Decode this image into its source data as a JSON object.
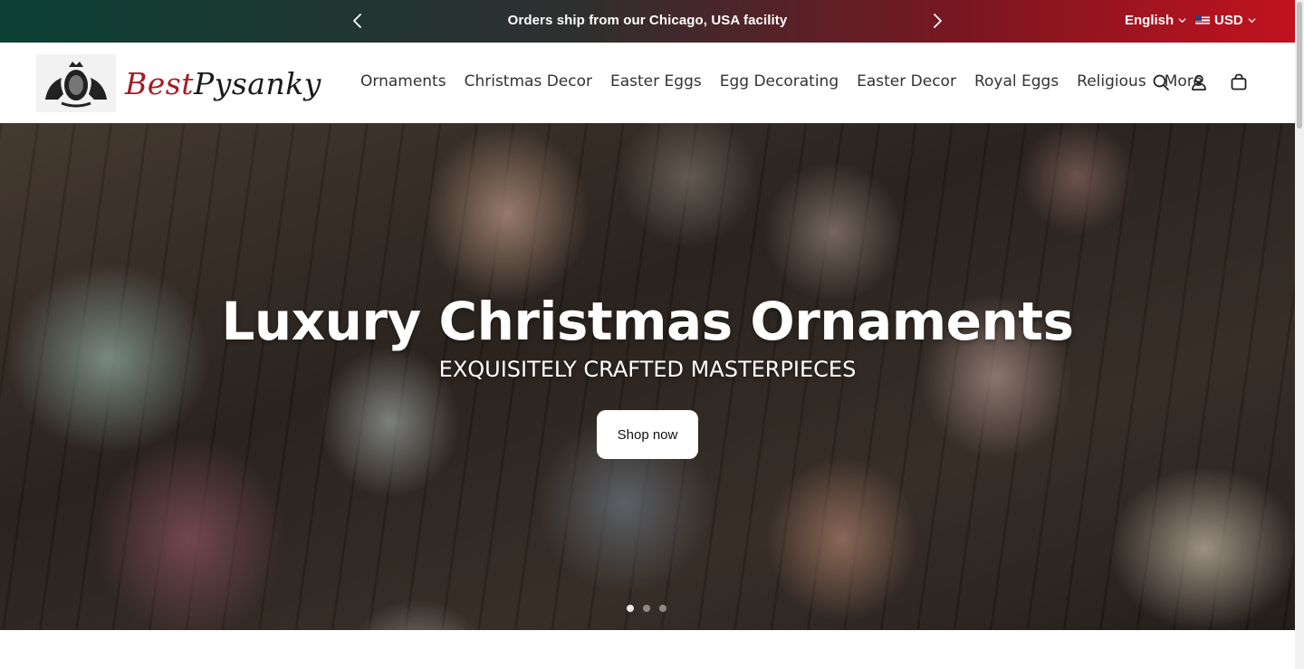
{
  "announcement": {
    "message": "Orders ship from our Chicago, USA facility",
    "language": "English",
    "currency": "USD"
  },
  "header": {
    "logo": {
      "part1": "Best",
      "part2": "Pysanky"
    },
    "nav": [
      {
        "label": "Ornaments"
      },
      {
        "label": "Christmas Decor"
      },
      {
        "label": "Easter Eggs"
      },
      {
        "label": "Egg Decorating"
      },
      {
        "label": "Easter Decor"
      },
      {
        "label": "Royal Eggs"
      },
      {
        "label": "Religious"
      },
      {
        "label": "More"
      }
    ],
    "icons": [
      "search-icon",
      "account-icon",
      "cart-icon"
    ]
  },
  "hero": {
    "title": "Luxury Christmas Ornaments",
    "subtitle": "EXQUISITELY CRAFTED MASTERPIECES",
    "button_label": "Shop now",
    "slides_total": 3,
    "active_slide": 1
  },
  "colors": {
    "announce_start": "#0b4034",
    "announce_end": "#c2121f",
    "logo_red": "#a51c24"
  }
}
